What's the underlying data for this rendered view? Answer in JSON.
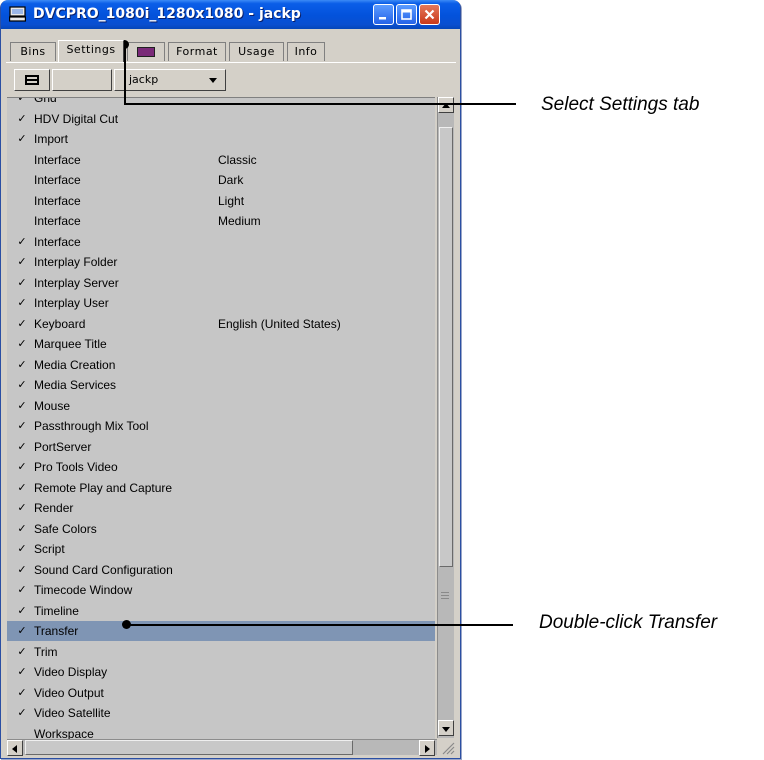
{
  "window": {
    "title": "DVCPRO_1080i_1280x1080 - jackp"
  },
  "tabs": [
    {
      "label": "Bins"
    },
    {
      "label": "Settings"
    },
    {
      "label": "",
      "icon": "color-swatch-icon"
    },
    {
      "label": "Format"
    },
    {
      "label": "Usage"
    },
    {
      "label": "Info"
    }
  ],
  "toolbar": {
    "user_select_value": "jackp"
  },
  "settings_list": [
    {
      "checked": true,
      "name": "Grid",
      "value": ""
    },
    {
      "checked": true,
      "name": "HDV Digital Cut",
      "value": ""
    },
    {
      "checked": true,
      "name": "Import",
      "value": ""
    },
    {
      "checked": false,
      "name": "Interface",
      "value": "Classic"
    },
    {
      "checked": false,
      "name": "Interface",
      "value": "Dark"
    },
    {
      "checked": false,
      "name": "Interface",
      "value": "Light"
    },
    {
      "checked": false,
      "name": "Interface",
      "value": "Medium"
    },
    {
      "checked": true,
      "name": "Interface",
      "value": ""
    },
    {
      "checked": true,
      "name": "Interplay Folder",
      "value": ""
    },
    {
      "checked": true,
      "name": "Interplay Server",
      "value": ""
    },
    {
      "checked": true,
      "name": "Interplay User",
      "value": ""
    },
    {
      "checked": true,
      "name": "Keyboard",
      "value": "English (United States)"
    },
    {
      "checked": true,
      "name": "Marquee Title",
      "value": ""
    },
    {
      "checked": true,
      "name": "Media Creation",
      "value": ""
    },
    {
      "checked": true,
      "name": "Media Services",
      "value": ""
    },
    {
      "checked": true,
      "name": "Mouse",
      "value": ""
    },
    {
      "checked": true,
      "name": "Passthrough Mix Tool",
      "value": ""
    },
    {
      "checked": true,
      "name": "PortServer",
      "value": ""
    },
    {
      "checked": true,
      "name": "Pro Tools Video",
      "value": ""
    },
    {
      "checked": true,
      "name": "Remote Play and Capture",
      "value": ""
    },
    {
      "checked": true,
      "name": "Render",
      "value": ""
    },
    {
      "checked": true,
      "name": "Safe Colors",
      "value": ""
    },
    {
      "checked": true,
      "name": "Script",
      "value": ""
    },
    {
      "checked": true,
      "name": "Sound Card Configuration",
      "value": ""
    },
    {
      "checked": true,
      "name": "Timecode Window",
      "value": ""
    },
    {
      "checked": true,
      "name": "Timeline",
      "value": ""
    },
    {
      "checked": true,
      "name": "Transfer",
      "value": "",
      "selected": true
    },
    {
      "checked": true,
      "name": "Trim",
      "value": ""
    },
    {
      "checked": true,
      "name": "Video Display",
      "value": ""
    },
    {
      "checked": true,
      "name": "Video Output",
      "value": ""
    },
    {
      "checked": true,
      "name": "Video Satellite",
      "value": ""
    },
    {
      "checked": false,
      "name": "Workspace",
      "value": ""
    }
  ],
  "check_glyph": "✓",
  "annotations": {
    "select_settings": "Select Settings tab",
    "double_click_transfer": "Double-click Transfer"
  },
  "colors": {
    "titlebar": "#0352db",
    "panel": "#d4d0c8",
    "list_background": "#c6c6c6",
    "selected_row": "#7f95b4"
  }
}
